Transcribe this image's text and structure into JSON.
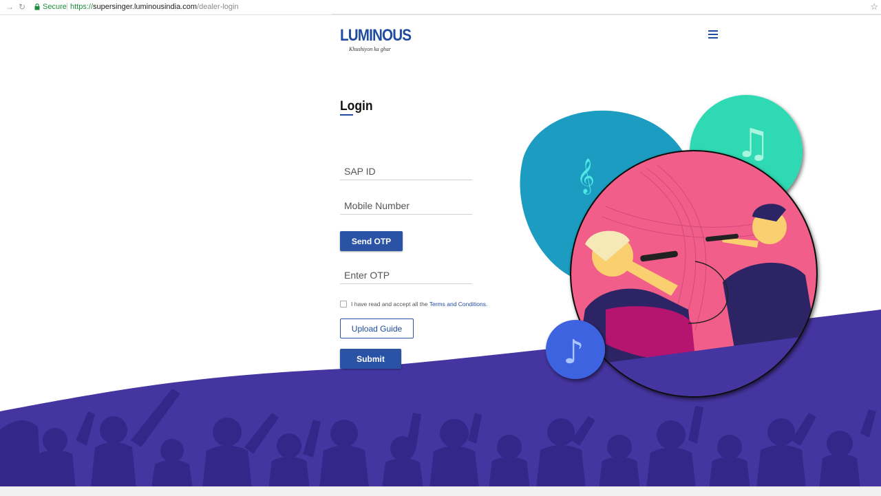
{
  "browser": {
    "secure_label": "Secure",
    "url_scheme": "https://",
    "url_host": "supersinger.luminousindia.com",
    "url_path": "/dealer-login",
    "icons": [
      "back-icon",
      "forward-icon",
      "reload-icon",
      "lock-icon",
      "bookmark-star-icon"
    ]
  },
  "header": {
    "brand": "LUMINOUS",
    "tagline": "Khushiyon ka ghar",
    "menu_icon": "hamburger-menu-icon"
  },
  "login": {
    "title": "Login",
    "sap_id_placeholder": "SAP ID",
    "mobile_placeholder": "Mobile Number",
    "send_otp_label": "Send OTP",
    "otp_placeholder": "Enter OTP",
    "terms_text": "I have read and accept all the ",
    "terms_link": "Terms and Conditions",
    "terms_suffix": ".",
    "upload_guide_label": "Upload Guide",
    "submit_label": "Submit"
  },
  "colors": {
    "brand_blue": "#1f4ba1",
    "button_blue": "#2a53a6",
    "wave_purple": "#4535a0",
    "crowd_purple": "#3a2b8a",
    "teal_blob": "#1b9cc0",
    "mint_circle": "#2fd9b3",
    "pink_circle": "#f25e8a"
  }
}
